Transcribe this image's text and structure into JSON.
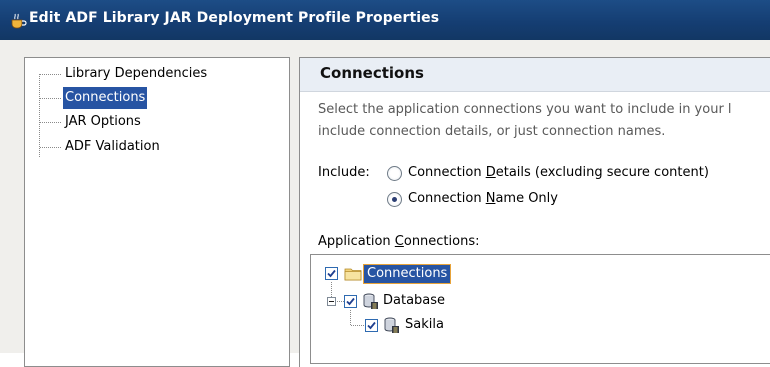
{
  "window": {
    "title": "Edit ADF Library JAR Deployment Profile Properties"
  },
  "navigation": {
    "items": [
      {
        "label": "Library Dependencies",
        "selected": false
      },
      {
        "label": "Connections",
        "selected": true
      },
      {
        "label": "JAR Options",
        "selected": false
      },
      {
        "label": "ADF Validation",
        "selected": false
      }
    ]
  },
  "panel": {
    "title": "Connections",
    "description_line1": "Select the application connections you want to include in your l",
    "description_line2": "include connection details, or just connection names.",
    "include_label": "Include:",
    "radio_details_pre": "Connection ",
    "radio_details_mnemonic": "D",
    "radio_details_post": "etails (excluding secure content)",
    "radio_name_pre": "Connection ",
    "radio_name_mnemonic": "N",
    "radio_name_post": "ame Only",
    "selected_radio": "Connection Name Only",
    "app_conn_pre": "Application ",
    "app_conn_mnemonic": "C",
    "app_conn_post": "onnections:"
  },
  "tree": {
    "root": {
      "label": "Connections",
      "checked": true
    },
    "database": {
      "label": "Database",
      "checked": true
    },
    "sakila": {
      "label": "Sakila",
      "checked": true
    }
  },
  "colors": {
    "titlebar": "#153e73",
    "selection": "#2754a3",
    "section_header": "#e9eef5",
    "focus_border": "#e7a33a"
  }
}
